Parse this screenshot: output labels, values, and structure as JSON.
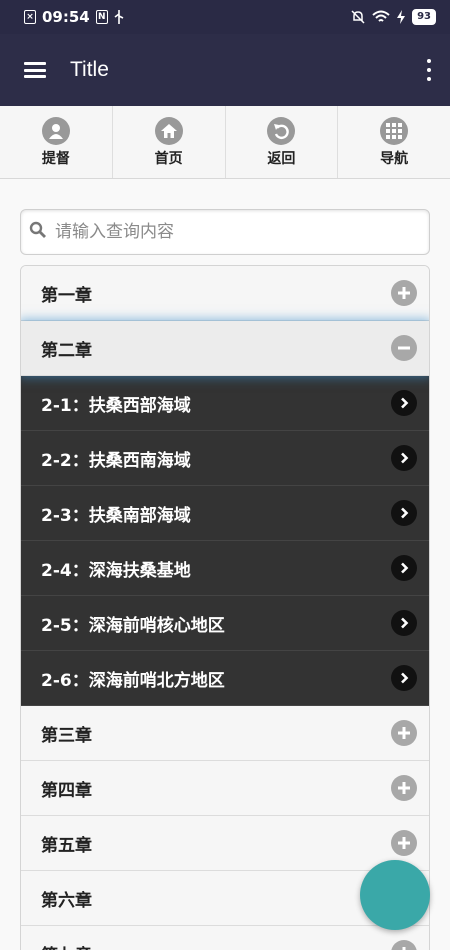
{
  "status_bar": {
    "time": "09:54",
    "battery": "93"
  },
  "app_bar": {
    "title": "Title"
  },
  "nav": [
    {
      "label": "提督",
      "icon": "user-icon"
    },
    {
      "label": "首页",
      "icon": "home-icon"
    },
    {
      "label": "返回",
      "icon": "back-icon"
    },
    {
      "label": "导航",
      "icon": "grid-icon"
    }
  ],
  "search": {
    "placeholder": "请输入查询内容",
    "value": ""
  },
  "chapters": {
    "c1": "第一章",
    "c2": "第二章",
    "c3": "第三章",
    "c4": "第四章",
    "c5": "第五章",
    "c6": "第六章",
    "c7": "第七章"
  },
  "levels": [
    "2-1：扶桑西部海域",
    "2-2：扶桑西南海域",
    "2-3：扶桑南部海域",
    "2-4：深海扶桑基地",
    "2-5：深海前哨核心地区",
    "2-6：深海前哨北方地区"
  ],
  "colors": {
    "app_bar": "#2d2d48",
    "sub_rows": "#333333",
    "fab": "#3aa8a8",
    "focus_glow": "#388ccb"
  }
}
